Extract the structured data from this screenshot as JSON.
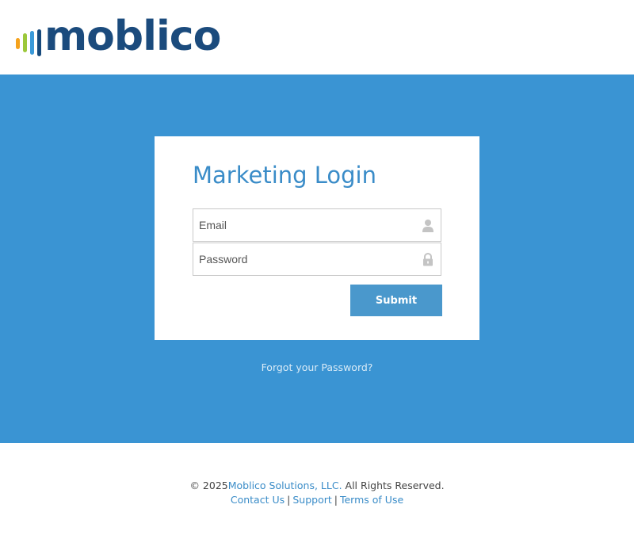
{
  "brand": {
    "logo_text": "moblico",
    "colors": {
      "bar1": "#f5a21c",
      "bar2": "#9cc83a",
      "bar3": "#3a9ad9",
      "bar4": "#174a7c",
      "text": "#1b4b7d",
      "band": "#3a94d3"
    }
  },
  "login": {
    "title": "Marketing Login",
    "email": {
      "placeholder": "Email",
      "value": "",
      "icon": "user-icon"
    },
    "password": {
      "placeholder": "Password",
      "value": "",
      "icon": "lock-icon"
    },
    "submit_label": "Submit",
    "forgot_label": "Forgot your Password?"
  },
  "footer": {
    "copyright_prefix": "© 2025",
    "company_link": "Moblico Solutions, LLC.",
    "rights": " All Rights Reserved.",
    "links": {
      "contact": "Contact Us",
      "support": "Support",
      "terms": "Terms of Use"
    },
    "separator": "|"
  }
}
